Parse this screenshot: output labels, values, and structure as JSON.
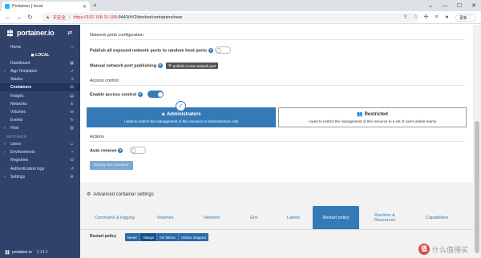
{
  "browser": {
    "tab_title": "Portainer | local",
    "insecure_label": "不安全",
    "url_host": "https://192.168.10.186",
    "url_rest": ":9443/#!/2/docker/containers/new",
    "update_label": "更新"
  },
  "sidebar": {
    "brand": "portainer.io",
    "env_label": "LOCAL",
    "items": [
      {
        "label": "Home"
      },
      {
        "label": "Dashboard"
      },
      {
        "label": "App Templates"
      },
      {
        "label": "Stacks"
      },
      {
        "label": "Containers"
      },
      {
        "label": "Images"
      },
      {
        "label": "Networks"
      },
      {
        "label": "Volumes"
      },
      {
        "label": "Events"
      },
      {
        "label": "Host"
      }
    ],
    "settings_section": "SETTINGS",
    "settings_items": [
      {
        "label": "Users"
      },
      {
        "label": "Environments"
      },
      {
        "label": "Registries"
      },
      {
        "label": "Authentication logs"
      },
      {
        "label": "Settings"
      }
    ],
    "footer_brand": "portainer.io",
    "version": "2.14.2"
  },
  "form": {
    "network_section": "Network ports configuration",
    "publish_all_label": "Publish all exposed network ports to random host ports",
    "publish_all_on": false,
    "manual_publish_label": "Manual network port publishing",
    "publish_new_btn": "publish a new network port",
    "access_section": "Access control",
    "enable_access_label": "Enable access control",
    "enable_access_on": true,
    "admins_title": "Administrators",
    "admins_desc": "I want to restrict the management of this resource to administrators only",
    "restricted_title": "Restricted",
    "restricted_desc": "I want to restrict the management of this resource to a set of users and/or teams",
    "actions_section": "Actions",
    "auto_remove_label": "Auto remove",
    "auto_remove_on": false,
    "deploy_btn": "Deploy the container"
  },
  "advanced": {
    "title": "Advanced container settings",
    "tabs": [
      {
        "label": "Command & logging"
      },
      {
        "label": "Volumes"
      },
      {
        "label": "Network"
      },
      {
        "label": "Env"
      },
      {
        "label": "Labels"
      },
      {
        "label": "Restart policy"
      },
      {
        "label": "Runtime & Resources"
      },
      {
        "label": "Capabilities"
      }
    ],
    "active_tab": "Restart policy",
    "restart_policy_label": "Restart policy",
    "restart_options": [
      {
        "label": "Never"
      },
      {
        "label": "Always"
      },
      {
        "label": "On failure"
      },
      {
        "label": "Unless stopped"
      }
    ],
    "restart_selected": "Always"
  },
  "watermark": {
    "text": "什么值得买",
    "logo_char": "值"
  },
  "colors": {
    "sidebar_bg": "#30426a",
    "accent": "#337ab7"
  }
}
